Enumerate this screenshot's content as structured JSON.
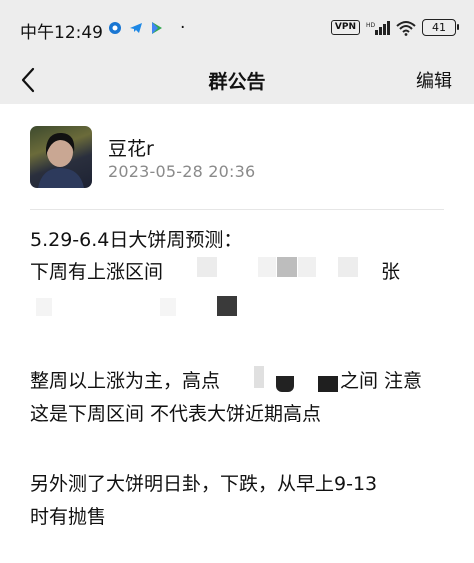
{
  "status_bar": {
    "time": "中午12:49",
    "dot": "·",
    "vpn": "VPN",
    "battery": "41"
  },
  "nav": {
    "title": "群公告",
    "edit": "编辑"
  },
  "post": {
    "author": "豆花r",
    "date": "2023-05-28 20:36",
    "lines": [
      "5.29-6.4日大饼周预测：",
      "下周有上涨区间",
      "张",
      "整周以上涨为主，高点",
      "之间 注意",
      "这是下周区间 不代表大饼近期高点",
      "另外测了大饼明日卦，下跌，从早上9-13",
      "时有抛售"
    ]
  }
}
